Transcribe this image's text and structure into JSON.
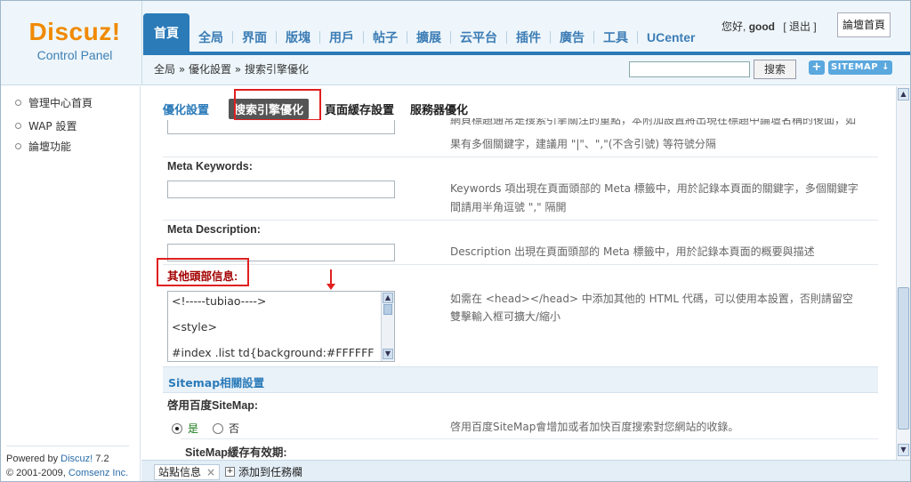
{
  "brand": {
    "logo_text": "Discuz!",
    "subtitle": "Control Panel"
  },
  "nav": {
    "tabs": [
      {
        "label": "首頁",
        "active": true
      },
      {
        "label": "全局"
      },
      {
        "label": "界面"
      },
      {
        "label": "版塊"
      },
      {
        "label": "用戶"
      },
      {
        "label": "帖子"
      },
      {
        "label": "擴展"
      },
      {
        "label": "云平台"
      },
      {
        "label": "插件"
      },
      {
        "label": "廣告"
      },
      {
        "label": "工具"
      },
      {
        "label": "UCenter"
      }
    ]
  },
  "user": {
    "greeting": "您好,",
    "name": "good",
    "logout": "[ 退出 ]",
    "home_button": "論壇首頁"
  },
  "breadcrumb": "全局 » 優化設置 » 搜索引擎優化",
  "search": {
    "button": "搜索",
    "placeholder": ""
  },
  "header_buttons": {
    "plus": "+",
    "sitemap": "SITEMAP ↓"
  },
  "sidebar": {
    "items": [
      {
        "label": "管理中心首頁"
      },
      {
        "label": "WAP 設置"
      },
      {
        "label": "論壇功能"
      }
    ],
    "footer_line1_prefix": "Powered by ",
    "footer_line1_link": "Discuz!",
    "footer_line1_version": " 7.2",
    "footer_line2_prefix": "© 2001-2009, ",
    "footer_line2_link": "Comsenz Inc."
  },
  "subtabs": {
    "section": "優化設置",
    "items": [
      {
        "label": "搜索引擎優化",
        "active": true
      },
      {
        "label": "頁面緩存設置"
      },
      {
        "label": "服務器優化"
      }
    ]
  },
  "fields": {
    "top_help_line1": "網頁標題通常是搜索引擎關注的重點，本附加設置將出現在標題中論壇名稱的後面，如",
    "top_help_line2": "果有多個關鍵字，建議用 \"|\"、\",\"(不含引號) 等符號分隔",
    "keywords_label": "Meta Keywords:",
    "keywords_help_line1": "Keywords 項出現在頁面頭部的 Meta 標籤中，用於記錄本頁面的關鍵字，多個關鍵字",
    "keywords_help_line2": "間請用半角逗號 \",\" 隔開",
    "description_label": "Meta Description:",
    "description_help": "Description 出現在頁面頭部的 Meta 標籤中，用於記錄本頁面的概要與描述",
    "head_label": "其他頭部信息:",
    "head_help_line1": "如需在 <head></head> 中添加其他的 HTML 代碼，可以使用本設置，否則請留空",
    "head_help_line2": "雙擊輸入框可擴大/縮小",
    "head_value_lines": [
      "<!-----tubiao---->",
      "<style>",
      "#index .list td{background:#FFFFFF"
    ]
  },
  "sitemap_section": {
    "title": "Sitemap相關設置",
    "enable_label": "啓用百度SiteMap:",
    "yes": "是",
    "no": "否",
    "enable_help": "啓用百度SiteMap會增加或者加快百度搜索對您網站的收錄。",
    "expire_label": "SiteMap緩存有效期:"
  },
  "taskbar": {
    "tab_label": "站點信息",
    "close": "×",
    "add_checkbox": "+",
    "add_label": "添加到任務欄"
  }
}
